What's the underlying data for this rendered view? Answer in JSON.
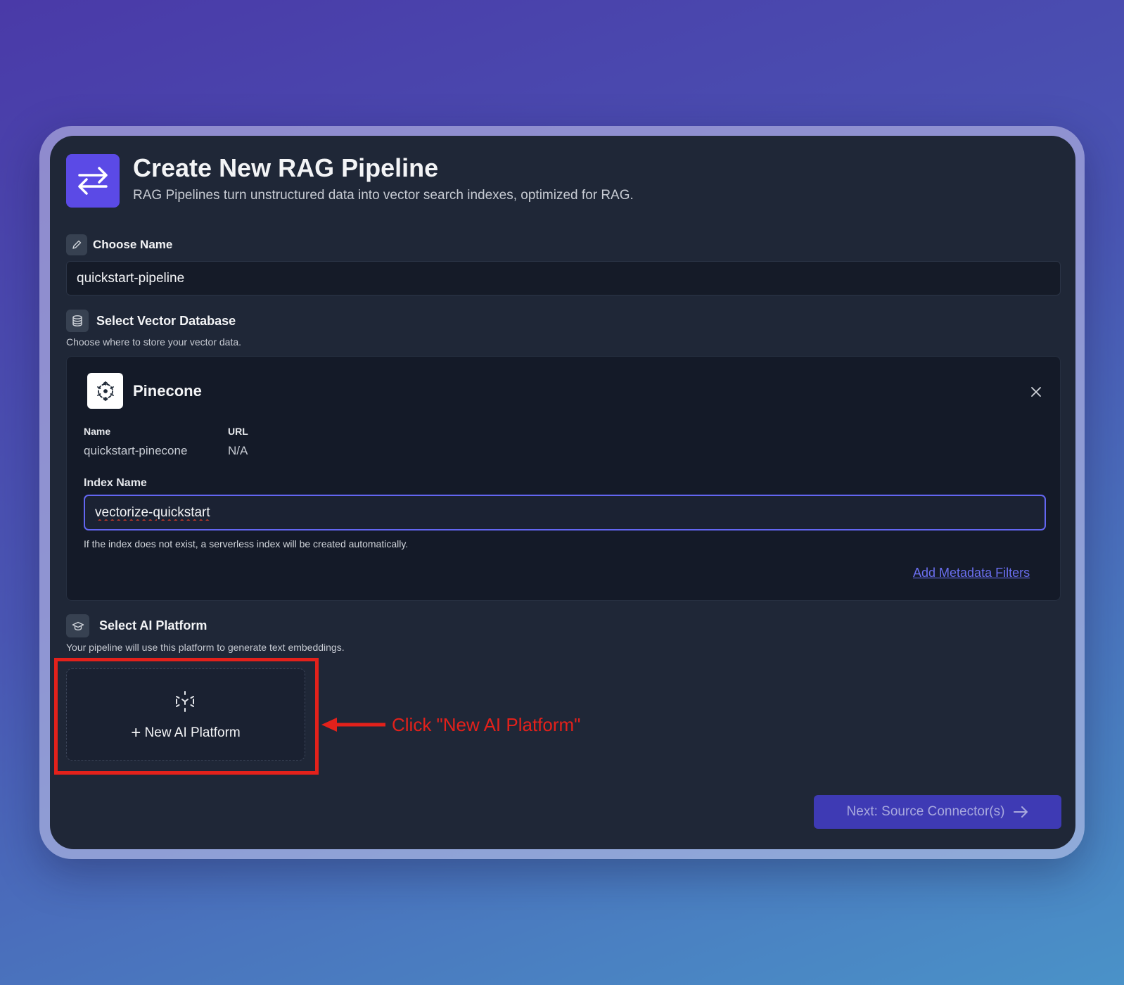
{
  "header": {
    "title": "Create New RAG Pipeline",
    "subtitle": "RAG Pipelines turn unstructured data into vector search indexes, optimized for RAG."
  },
  "name_section": {
    "title": "Choose Name",
    "value": "quickstart-pipeline"
  },
  "vector_db_section": {
    "title": "Select Vector Database",
    "hint": "Choose where to store your vector data.",
    "selected": {
      "provider": "Pinecone",
      "name_label": "Name",
      "name_value": "quickstart-pinecone",
      "url_label": "URL",
      "url_value": "N/A",
      "index_label": "Index Name",
      "index_value": "vectorize-quickstart",
      "index_hint": "If the index does not exist, a serverless index will be created automatically.",
      "metadata_link": "Add Metadata Filters"
    }
  },
  "ai_platform_section": {
    "title": "Select AI Platform",
    "hint": "Your pipeline will use this platform to generate text embeddings.",
    "new_button": "New AI Platform"
  },
  "annotation": {
    "callout": "Click \"New AI Platform\"",
    "color": "#e3211b"
  },
  "footer": {
    "next_button": "Next: Source Connector(s)"
  },
  "colors": {
    "accent": "#5b4ae6",
    "panel": "#1f2737",
    "link": "#6b6ff0"
  }
}
